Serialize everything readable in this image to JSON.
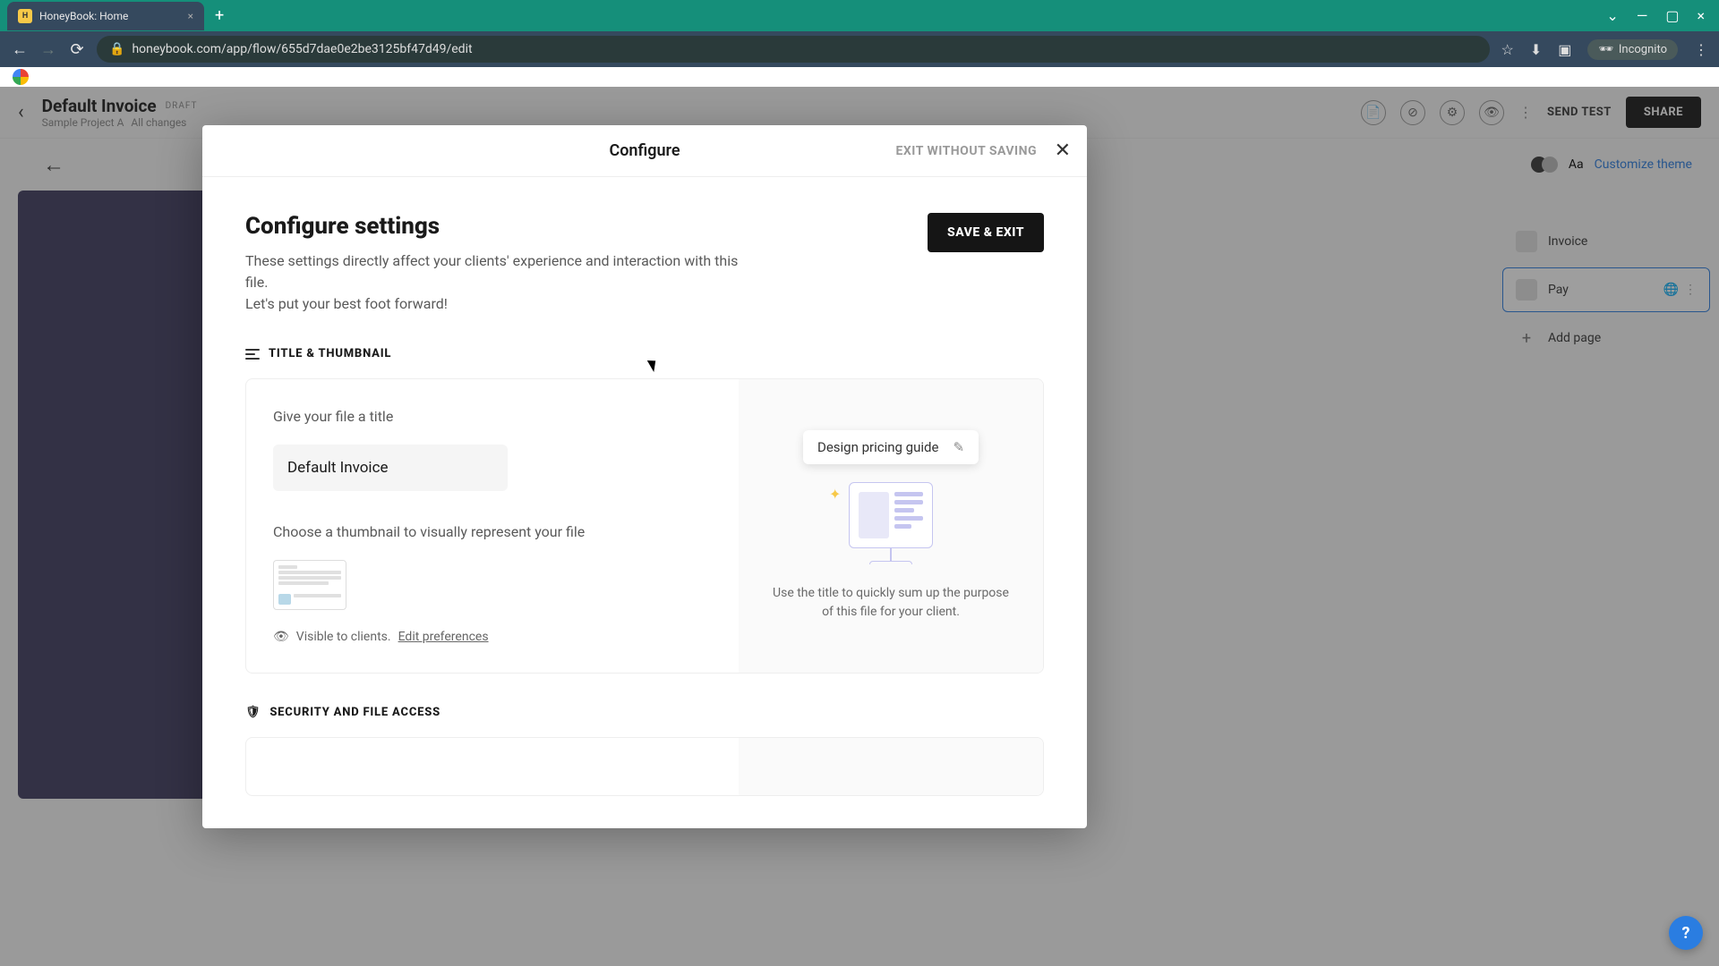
{
  "browser": {
    "tab_title": "HoneyBook: Home",
    "url": "honeybook.com/app/flow/655d7dae0e2be3125bf47d49/edit",
    "incognito_label": "Incognito"
  },
  "app_header": {
    "title": "Default Invoice",
    "badge": "DRAFT",
    "project": "Sample Project A",
    "save_status": "All changes",
    "send_test": "SEND TEST",
    "share": "SHARE"
  },
  "sub_toolbar": {
    "font_label": "Aa",
    "customize": "Customize theme"
  },
  "right_panel": {
    "items": [
      {
        "label": "Invoice"
      },
      {
        "label": "Pay"
      },
      {
        "label": "Add page"
      }
    ]
  },
  "modal": {
    "title": "Configure",
    "exit_no_save": "EXIT WITHOUT SAVING",
    "heading": "Configure settings",
    "description_line1": "These settings directly affect your clients' experience and interaction with this file.",
    "description_line2": "Let's put your best foot forward!",
    "save_exit": "SAVE & EXIT",
    "section_title_thumb": "TITLE & THUMBNAIL",
    "title_field_label": "Give your file a title",
    "title_value": "Default Invoice",
    "thumbnail_label": "Choose a thumbnail to visually represent your file",
    "visibility_text": "Visible to clients.",
    "edit_preferences": "Edit preferences",
    "preview_chip": "Design pricing guide",
    "preview_hint": "Use the title to quickly sum up the purpose of this file for your client.",
    "section_security": "SECURITY AND FILE ACCESS"
  },
  "help": {
    "label": "?"
  }
}
